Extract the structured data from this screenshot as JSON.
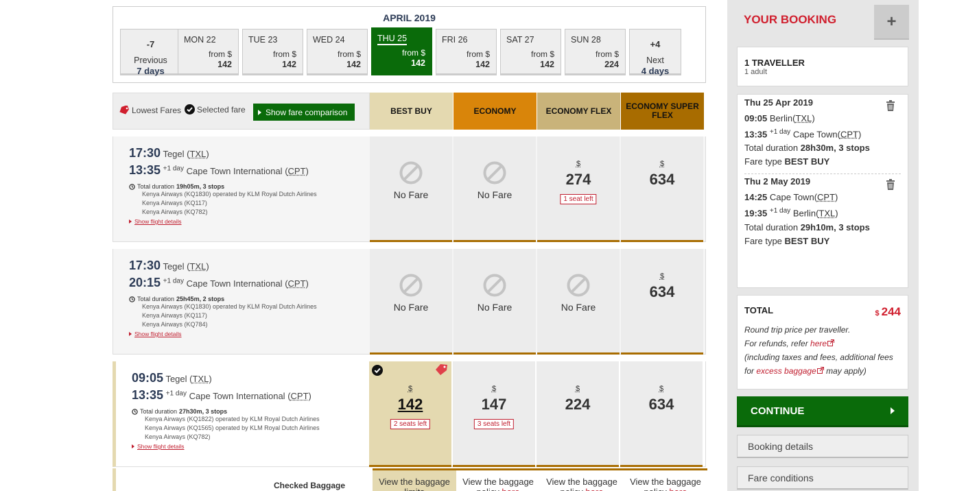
{
  "date_strip": {
    "month": "APRIL 2019",
    "prev": {
      "n": "-7",
      "label": "Previous",
      "days": "7 days"
    },
    "next": {
      "n": "+4",
      "label": "Next",
      "days": "4 days"
    },
    "days": [
      {
        "name": "MON 22",
        "from": "from $",
        "price": "142"
      },
      {
        "name": "TUE 23",
        "from": "from $",
        "price": "142"
      },
      {
        "name": "WED 24",
        "from": "from $",
        "price": "142"
      },
      {
        "name": "THU 25",
        "from": "from $",
        "price": "142"
      },
      {
        "name": "FRI 26",
        "from": "from $",
        "price": "142"
      },
      {
        "name": "SAT 27",
        "from": "from $",
        "price": "142"
      },
      {
        "name": "SUN 28",
        "from": "from $",
        "price": "224"
      }
    ]
  },
  "legend": {
    "lowest": "Lowest Fares",
    "selected": "Selected fare",
    "compare_btn": "Show fare comparison"
  },
  "fare_headers": [
    {
      "label": "BEST BUY",
      "color": "#e4d9b0"
    },
    {
      "label": "ECONOMY",
      "color": "#d9850a"
    },
    {
      "label": "ECONOMY FLEX",
      "color": "#c9b37a"
    },
    {
      "label": "ECONOMY SUPER FLEX",
      "color": "#a86c00"
    }
  ],
  "flights": [
    {
      "dep_time": "17:30",
      "dep_airport": "Tegel",
      "dep_code": "TXL",
      "arr_time": "13:35",
      "arr_plus": "+1 day",
      "arr_airport": "Cape Town International",
      "arr_code": "CPT",
      "duration_label": "Total duration",
      "duration": "19h05m, 3 stops",
      "carriers": [
        "Kenya Airways (KQ1830) operated by KLM Royal Dutch Airlines",
        "Kenya Airways (KQ117)",
        "Kenya Airways (KQ782)"
      ],
      "details_link": "Show flight details",
      "fares": [
        {
          "no_fare": "No Fare"
        },
        {
          "no_fare": "No Fare"
        },
        {
          "currency": "$",
          "amount": "274",
          "seats": "1 seat left"
        },
        {
          "currency": "$",
          "amount": "634"
        }
      ]
    },
    {
      "dep_time": "17:30",
      "dep_airport": "Tegel",
      "dep_code": "TXL",
      "arr_time": "20:15",
      "arr_plus": "+1 day",
      "arr_airport": "Cape Town International",
      "arr_code": "CPT",
      "duration_label": "Total duration",
      "duration": "25h45m, 2 stops",
      "carriers": [
        "Kenya Airways (KQ1830) operated by KLM Royal Dutch Airlines",
        "Kenya Airways (KQ117)",
        "Kenya Airways (KQ784)"
      ],
      "details_link": "Show flight details",
      "fares": [
        {
          "no_fare": "No Fare"
        },
        {
          "no_fare": "No Fare"
        },
        {
          "no_fare": "No Fare"
        },
        {
          "currency": "$",
          "amount": "634"
        }
      ]
    },
    {
      "dep_time": "09:05",
      "dep_airport": "Tegel",
      "dep_code": "TXL",
      "arr_time": "13:35",
      "arr_plus": "+1 day",
      "arr_airport": "Cape Town International",
      "arr_code": "CPT",
      "duration_label": "Total duration",
      "duration": "27h30m, 3 stops",
      "carriers": [
        "Kenya Airways (KQ1822) operated by KLM Royal Dutch Airlines",
        "Kenya Airways (KQ1565) operated by KLM Royal Dutch Airlines",
        "Kenya Airways (KQ782)"
      ],
      "details_link": "Show flight details",
      "fares": [
        {
          "currency": "$",
          "amount": "142",
          "seats": "2 seats left"
        },
        {
          "currency": "$",
          "amount": "147",
          "seats": "3 seats left"
        },
        {
          "currency": "$",
          "amount": "224"
        },
        {
          "currency": "$",
          "amount": "634"
        }
      ]
    }
  ],
  "baggage": {
    "title": "Checked Baggage",
    "cells": [
      {
        "text": "View the baggage",
        "text2": "limits"
      },
      {
        "text": "View the baggage",
        "text2": "policy",
        "link": "here"
      },
      {
        "text": "View the baggage",
        "text2": "policy",
        "link": "here"
      },
      {
        "text": "View the baggage",
        "text2": "policy",
        "link": "here"
      }
    ]
  },
  "sidebar": {
    "title": "YOUR BOOKING",
    "plus": "+",
    "traveller": {
      "title": "1 TRAVELLER",
      "sub": "1 adult"
    },
    "legs": [
      {
        "date": "Thu 25 Apr 2019",
        "dep_time": "09:05",
        "dep_city": "Berlin",
        "dep_code": "TXL",
        "arr_time": "13:35",
        "arr_plus": "+1 day",
        "arr_city": "Cape Town",
        "arr_code": "CPT",
        "duration_label": "Total duration",
        "duration": "28h30m, 3 stops",
        "fare_label": "Fare type",
        "fare": "BEST BUY"
      },
      {
        "date": "Thu 2 May 2019",
        "dep_time": "14:25",
        "dep_city": "Cape Town",
        "dep_code": "CPT",
        "arr_time": "19:35",
        "arr_plus": "+1 day",
        "arr_city": "Berlin",
        "arr_code": "TXL",
        "duration_label": "Total duration",
        "duration": "29h10m, 3 stops",
        "fare_label": "Fare type",
        "fare": "BEST BUY"
      }
    ],
    "total": {
      "label": "TOTAL",
      "currency": "$",
      "amount": "244",
      "note1": "Round trip price per traveller.",
      "note2": "For refunds, refer",
      "note2_link": "here",
      "note3": "(including taxes and fees, additional fees for",
      "note3_link": "excess baggage",
      "note3_end": "may apply)"
    },
    "continue": "CONTINUE",
    "links": [
      "Booking details",
      "Fare conditions"
    ]
  }
}
